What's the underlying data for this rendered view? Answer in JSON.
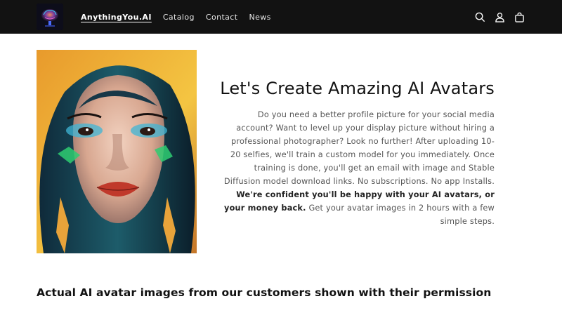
{
  "header": {
    "brand": "AnythingYou.AI",
    "nav": [
      "Catalog",
      "Contact",
      "News"
    ],
    "icons": [
      "search-icon",
      "account-icon",
      "cart-icon"
    ],
    "background": "#121212"
  },
  "hero": {
    "title": "Let's Create Amazing AI Avatars",
    "body_1": "Do you need a better profile picture for your social media account? Want to level up your display picture without hiring a professional photographer? Look no further! After uploading 10-20 selfies, we'll train a custom model for you immediately. Once training is done, you'll get an email with image and Stable Diffusion model download links. No subscriptions. No app Installs.",
    "body_bold": "We're confident you'll be happy with your AI avatars, or your money back.",
    "body_2": "Get your avatar images in 2 hours with a few simple steps."
  },
  "gallery": {
    "title": "Actual AI avatar images from our customers shown with their permission"
  }
}
